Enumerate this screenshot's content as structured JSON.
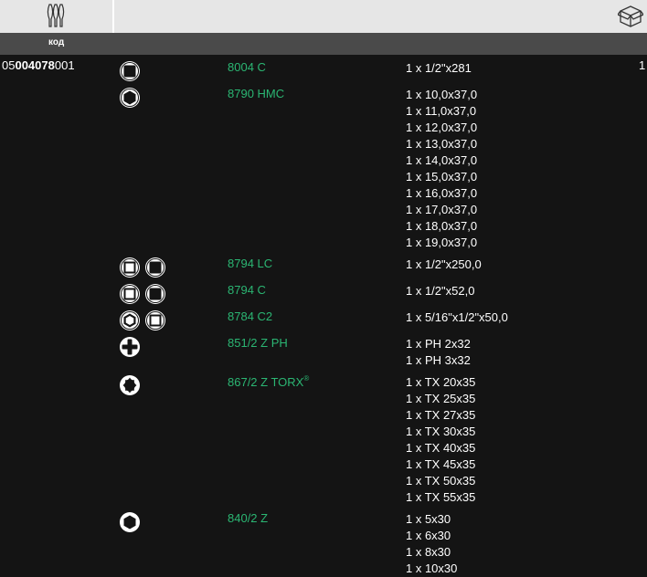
{
  "header": {
    "code_label": "код"
  },
  "article": {
    "code_prefix": "05",
    "code_bold": "004078",
    "code_suffix": "001",
    "quantity": "1"
  },
  "rows": [
    {
      "icons": [
        "square-drive-icon"
      ],
      "model": "8004 C",
      "model_sup": "",
      "dims": [
        "1 x 1/2\"x281"
      ]
    },
    {
      "icons": [
        "hex-socket-icon"
      ],
      "model": "8790 HMC",
      "model_sup": "",
      "dims": [
        "1 x 10,0x37,0",
        "1 x 11,0x37,0",
        "1 x 12,0x37,0",
        "1 x 13,0x37,0",
        "1 x 14,0x37,0",
        "1 x 15,0x37,0",
        "1 x 16,0x37,0",
        "1 x 17,0x37,0",
        "1 x 18,0x37,0",
        "1 x 19,0x37,0"
      ]
    },
    {
      "icons": [
        "square-drive-icon",
        "square-drive-icon"
      ],
      "model": "8794 LC",
      "model_sup": "",
      "dims": [
        "1 x 1/2\"x250,0"
      ]
    },
    {
      "icons": [
        "square-drive-icon",
        "square-drive-icon"
      ],
      "model": "8794 C",
      "model_sup": "",
      "dims": [
        "1 x 1/2\"x52,0"
      ]
    },
    {
      "icons": [
        "hex-socket-icon",
        "square-drive-icon"
      ],
      "model": "8784 C2",
      "model_sup": "",
      "dims": [
        "1 x 5/16\"x1/2\"x50,0"
      ]
    },
    {
      "icons": [
        "phillips-icon"
      ],
      "model": "851/2 Z PH",
      "model_sup": "",
      "dims": [
        "1 x PH 2x32",
        "1 x PH 3x32"
      ]
    },
    {
      "icons": [
        "torx-icon"
      ],
      "model": "867/2 Z TORX",
      "model_sup": "®",
      "dims": [
        "1 x TX 20x35",
        "1 x TX 25x35",
        "1 x TX 27x35",
        "1 x TX 30x35",
        "1 x TX 40x35",
        "1 x TX 45x35",
        "1 x TX 50x35",
        "1 x TX 55x35"
      ]
    },
    {
      "icons": [
        "hex-bit-icon"
      ],
      "model": "840/2 Z",
      "model_sup": "",
      "dims": [
        "1 x 5x30",
        "1 x 6x30",
        "1 x 8x30",
        "1 x 10x30"
      ]
    }
  ]
}
